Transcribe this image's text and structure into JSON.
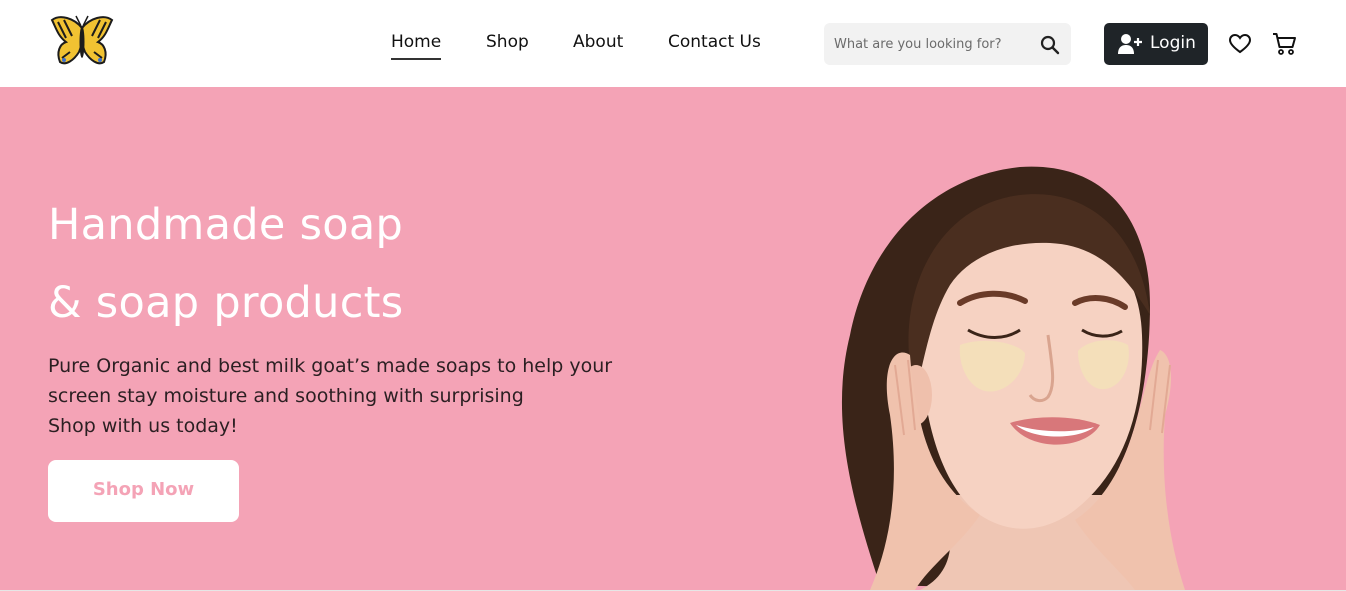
{
  "header": {
    "logo_icon": "butterfly-logo-icon",
    "nav": [
      {
        "label": "Home",
        "active": true
      },
      {
        "label": "Shop",
        "active": false
      },
      {
        "label": "About",
        "active": false
      },
      {
        "label": "Contact Us",
        "active": false
      }
    ],
    "search": {
      "placeholder": "What are you looking for?",
      "icon": "search-icon"
    },
    "login": {
      "label": "Login",
      "icon": "user-plus-icon"
    },
    "wishlist_icon": "heart-icon",
    "cart_icon": "cart-icon"
  },
  "hero": {
    "title_lines": [
      "Handmade soap",
      "& soap products"
    ],
    "description_lines": [
      "Pure Organic and best milk goat’s made soaps to help your",
      "screen stay moisture and soothing with surprising",
      "Shop with us today!"
    ],
    "cta_label": "Shop Now",
    "image": "smiling-woman-with-eye-patches"
  },
  "colors": {
    "hero_bg": "#f4a3b6",
    "login_bg": "#1f2428",
    "accent": "#f4a3b6"
  }
}
